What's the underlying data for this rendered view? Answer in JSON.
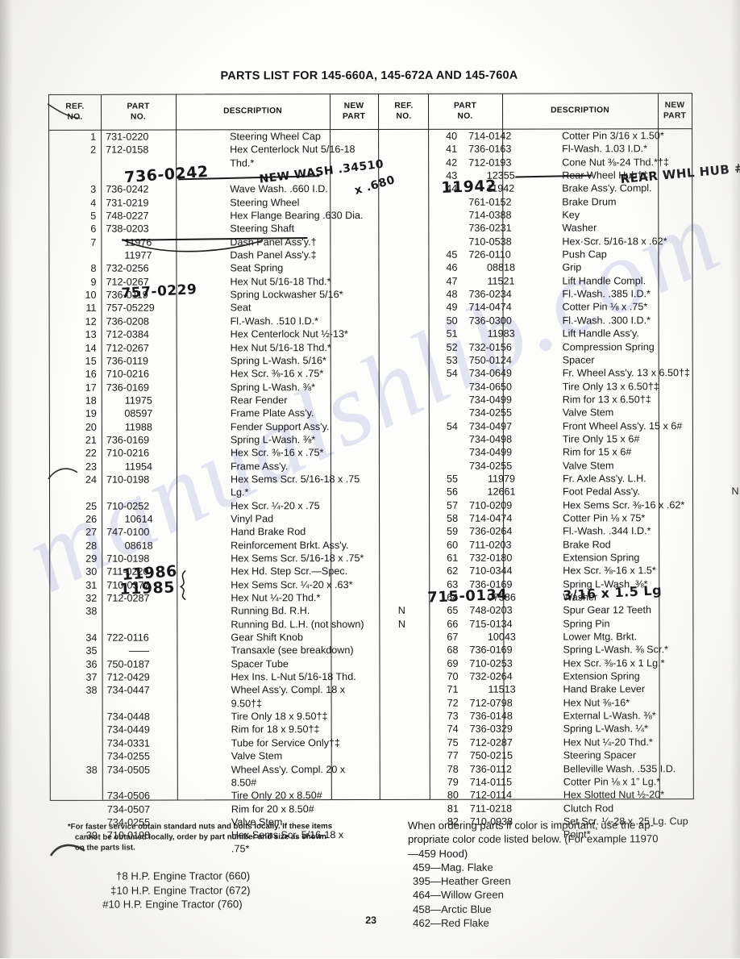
{
  "document": {
    "title": "PARTS LIST FOR 145-660A, 145-672A AND 145-760A",
    "page_number": "23"
  },
  "table": {
    "headers": {
      "ref_no_line1": "REF.",
      "ref_no_line2": "NO.",
      "part_no_line1": "PART",
      "part_no_line2": "NO.",
      "description": "DESCRIPTION",
      "new_part_line1": "NEW",
      "new_part_line2": "PART"
    },
    "left_rows": [
      {
        "ref": "1",
        "part": "731-0220",
        "desc": "Steering Wheel Cap",
        "new": ""
      },
      {
        "ref": "2",
        "part": "712-0158",
        "desc": "Hex Centerlock Nut 5/16-18\n   Thd.*",
        "new": "",
        "tall": true
      },
      {
        "ref": "",
        "part": "",
        "desc": "",
        "new": "",
        "gap": true
      },
      {
        "ref": "3",
        "part": "736-0242",
        "desc": "Wave Wash. .660 I.D.",
        "new": "",
        "struck": true
      },
      {
        "ref": "4",
        "part": "731-0219",
        "desc": "Steering Wheel",
        "new": ""
      },
      {
        "ref": "5",
        "part": "748-0227",
        "desc": "Hex Flange Bearing .630 Dia.",
        "new": ""
      },
      {
        "ref": "6",
        "part": "738-0203",
        "desc": "Steering Shaft",
        "new": ""
      },
      {
        "ref": "7",
        "part": "11976",
        "desc": "Dash Panel Ass'y.†",
        "new": "",
        "center": true
      },
      {
        "ref": "",
        "part": "11977",
        "desc": "Dash Panel Ass'y.‡",
        "new": "",
        "center": true,
        "struck": true
      },
      {
        "ref": "8",
        "part": "732-0256",
        "desc": "Seat Spring",
        "new": ""
      },
      {
        "ref": "9",
        "part": "712-0267",
        "desc": "Hex Nut 5/16-18 Thd.*",
        "new": ""
      },
      {
        "ref": "10",
        "part": "736-0119",
        "desc": "Spring Lockwasher 5/16*",
        "new": ""
      },
      {
        "ref": "11",
        "part": "757-05229",
        "desc": "Seat",
        "new": ""
      },
      {
        "ref": "12",
        "part": "736-0208",
        "desc": "Fl.-Wash. .510 I.D.*",
        "new": ""
      },
      {
        "ref": "13",
        "part": "712-0384",
        "desc": "Hex Centerlock Nut ½-13*",
        "new": ""
      },
      {
        "ref": "14",
        "part": "712-0267",
        "desc": "Hex Nut 5/16-18 Thd.*",
        "new": ""
      },
      {
        "ref": "15",
        "part": "736-0119",
        "desc": "Spring L-Wash. 5/16*",
        "new": ""
      },
      {
        "ref": "16",
        "part": "710-0216",
        "desc": "Hex Scr. ⅜-16 x .75*",
        "new": ""
      },
      {
        "ref": "17",
        "part": "736-0169",
        "desc": "Spring L-Wash. ⅜*",
        "new": ""
      },
      {
        "ref": "18",
        "part": "11975",
        "desc": "Rear Fender",
        "new": "",
        "center": true
      },
      {
        "ref": "19",
        "part": "08597",
        "desc": "Frame Plate Ass'y.",
        "new": "",
        "center": true
      },
      {
        "ref": "20",
        "part": "11988",
        "desc": "Fender Support Ass'y.",
        "new": "",
        "center": true
      },
      {
        "ref": "21",
        "part": "736-0169",
        "desc": "Spring L-Wash. ⅜*",
        "new": ""
      },
      {
        "ref": "22",
        "part": "710-0216",
        "desc": "Hex Scr. ⅜-16 x .75*",
        "new": ""
      },
      {
        "ref": "23",
        "part": "11954",
        "desc": "Frame Ass'y.",
        "new": "",
        "center": true
      },
      {
        "ref": "24",
        "part": "710-0198",
        "desc": "Hex Sems Scr. 5/16-18 x .75\n   Lg.*",
        "new": "",
        "tall": true
      },
      {
        "ref": "25",
        "part": "710-0252",
        "desc": "Hex Scr. ¼-20 x .75",
        "new": ""
      },
      {
        "ref": "26",
        "part": "10614",
        "desc": "Vinyl Pad",
        "new": "",
        "center": true
      },
      {
        "ref": "27",
        "part": "747-0100",
        "desc": "Hand Brake Rod",
        "new": ""
      },
      {
        "ref": "28",
        "part": "08618",
        "desc": "Reinforcement Brkt.  Ass'y.",
        "new": "",
        "center": true
      },
      {
        "ref": "29",
        "part": "710-0198",
        "desc": "Hex Sems Scr. 5/16-18 x .75*",
        "new": ""
      },
      {
        "ref": "30",
        "part": "711-0220",
        "desc": "Hex Hd. Step Scr.—Spec.",
        "new": ""
      },
      {
        "ref": "31",
        "part": "710-0377",
        "desc": "Hex Sems Scr. ¼-20 x .63*",
        "new": ""
      },
      {
        "ref": "32",
        "part": "712-0287",
        "desc": "Hex Nut ¼-20 Thd.*",
        "new": ""
      },
      {
        "ref": "38",
        "part": "",
        "desc": "Running Bd. R.H.",
        "new": "N"
      },
      {
        "ref": "",
        "part": "",
        "desc": "Running Bd. L.H. (not shown)",
        "new": "N"
      },
      {
        "ref": "34",
        "part": "722-0116",
        "desc": "Gear Shift Knob",
        "new": ""
      },
      {
        "ref": "35",
        "part": "——",
        "desc": "Transaxle (see breakdown)",
        "new": "",
        "center": true
      },
      {
        "ref": "36",
        "part": "750-0187",
        "desc": "Spacer Tube",
        "new": ""
      },
      {
        "ref": "37",
        "part": "712-0429",
        "desc": "Hex Ins. L-Nut 5/16-18 Thd.",
        "new": ""
      },
      {
        "ref": "38",
        "part": "734-0447",
        "desc": "Wheel Ass'y. Compl. 18 x\n   9.50†‡",
        "new": "",
        "tall": true
      },
      {
        "ref": "",
        "part": "734-0448",
        "desc": "Tire Only 18 x 9.50†‡",
        "new": ""
      },
      {
        "ref": "",
        "part": "734-0449",
        "desc": "Rim for 18 x 9.50†‡",
        "new": ""
      },
      {
        "ref": "",
        "part": "734-0331",
        "desc": "Tube for Service Only†‡",
        "new": ""
      },
      {
        "ref": "",
        "part": "734-0255",
        "desc": "Valve Stem",
        "new": ""
      },
      {
        "ref": "38",
        "part": "734-0505",
        "desc": "Wheel Ass'y. Compl. 20 x\n   8.50#",
        "new": "",
        "tall": true
      },
      {
        "ref": "",
        "part": "734-0506",
        "desc": "Tire Only 20 x 8.50#",
        "new": ""
      },
      {
        "ref": "",
        "part": "734-0507",
        "desc": "Rim for 20 x 8.50#",
        "new": ""
      },
      {
        "ref": "",
        "part": "734-0255",
        "desc": "Valve Stem",
        "new": ""
      },
      {
        "ref": "39",
        "part": "710-0198",
        "desc": "Hex Sems Scr. 5/16-18 x\n   .75*",
        "new": "",
        "tall": true
      }
    ],
    "right_rows": [
      {
        "ref": "40",
        "part": "714-0142",
        "desc": "Cotter Pin 3/16 x 1.50*",
        "new": ""
      },
      {
        "ref": "41",
        "part": "736-0163",
        "desc": "Fl-Wash. 1.03 I.D.*",
        "new": ""
      },
      {
        "ref": "42",
        "part": "712-0193",
        "desc": "Cone Nut ⅜-24 Thd.*†‡",
        "new": ""
      },
      {
        "ref": "43",
        "part": "12355",
        "desc": "Rear Wheel Hub†‡",
        "new": "",
        "center": true
      },
      {
        "ref": "44",
        "part": "11942",
        "desc": "Brake Ass'y. Compl.",
        "new": "",
        "center": true
      },
      {
        "ref": "",
        "part": "761-0152",
        "desc": "Brake Drum",
        "new": ""
      },
      {
        "ref": "",
        "part": "714-0388",
        "desc": "Key",
        "new": ""
      },
      {
        "ref": "",
        "part": "736-0231",
        "desc": "Washer",
        "new": ""
      },
      {
        "ref": "",
        "part": "710-0538",
        "desc": "Hex·Scr. 5/16-18 x .62*",
        "new": ""
      },
      {
        "ref": "45",
        "part": "726-0110",
        "desc": "Push Cap",
        "new": ""
      },
      {
        "ref": "46",
        "part": "08818",
        "desc": "Grip",
        "new": "",
        "center": true
      },
      {
        "ref": "47",
        "part": "11521",
        "desc": "Lift Handle Compl.",
        "new": "",
        "center": true
      },
      {
        "ref": "48",
        "part": "736-0234",
        "desc": "Fl.-Wash. .385 I.D.*",
        "new": ""
      },
      {
        "ref": "49",
        "part": "714-0474",
        "desc": "Cotter Pin ⅛ x .75*",
        "new": ""
      },
      {
        "ref": "50",
        "part": "736-0300",
        "desc": "Fl.-Wash. .300 I.D.*",
        "new": ""
      },
      {
        "ref": "51",
        "part": "11983",
        "desc": "Lift Handle Ass'y.",
        "new": "",
        "center": true
      },
      {
        "ref": "52",
        "part": "732-0156",
        "desc": "Compression Spring",
        "new": ""
      },
      {
        "ref": "53",
        "part": "750-0124",
        "desc": "Spacer",
        "new": ""
      },
      {
        "ref": "54",
        "part": "734-0649",
        "desc": "Fr. Wheel Ass'y. 13 x 6.50†‡",
        "new": ""
      },
      {
        "ref": "",
        "part": "734-0650",
        "desc": "Tire Only 13 x 6.50†‡",
        "new": ""
      },
      {
        "ref": "",
        "part": "734-0499",
        "desc": "Rim for 13 x 6.50†‡",
        "new": ""
      },
      {
        "ref": "",
        "part": "734-0255",
        "desc": "Valve Stem",
        "new": ""
      },
      {
        "ref": "54",
        "part": "734-0497",
        "desc": "Front Wheel Ass'y. 15 x 6#",
        "new": ""
      },
      {
        "ref": "",
        "part": "734-0498",
        "desc": "Tire Only 15 x 6#",
        "new": ""
      },
      {
        "ref": "",
        "part": "734-0499",
        "desc": "Rim for 15 x 6#",
        "new": ""
      },
      {
        "ref": "",
        "part": "734-0255",
        "desc": "Valve Stem",
        "new": ""
      },
      {
        "ref": "55",
        "part": "11979",
        "desc": "Fr. Axle Ass'y. L.H.",
        "new": "",
        "center": true
      },
      {
        "ref": "56",
        "part": "12661",
        "desc": "Foot Pedal Ass'y.",
        "new": "N",
        "center": true
      },
      {
        "ref": "57",
        "part": "710-0209",
        "desc": "Hex Sems Scr. ⅜-16 x .62*",
        "new": ""
      },
      {
        "ref": "58",
        "part": "714-0474",
        "desc": "Cotter Pin ⅛ x 75*",
        "new": ""
      },
      {
        "ref": "59",
        "part": "736-0264",
        "desc": "Fl.-Wash. .344 I.D.*",
        "new": ""
      },
      {
        "ref": "60",
        "part": "711-0203",
        "desc": "Brake Rod",
        "new": ""
      },
      {
        "ref": "61",
        "part": "732-0180",
        "desc": "Extension Spring",
        "new": ""
      },
      {
        "ref": "62",
        "part": "710-0344",
        "desc": "Hex Scr. ⅜-16 x 1.5*",
        "new": ""
      },
      {
        "ref": "63",
        "part": "736-0169",
        "desc": "Spring L-Wash. ⅜*",
        "new": ""
      },
      {
        "ref": "64",
        "part": "07386",
        "desc": "Washer",
        "new": "",
        "center": true
      },
      {
        "ref": "65",
        "part": "748-0203",
        "desc": "Spur Gear 12 Teeth",
        "new": ""
      },
      {
        "ref": "66",
        "part": "715-0134",
        "desc": "Spring Pin",
        "new": ""
      },
      {
        "ref": "67",
        "part": "10043",
        "desc": "Lower Mtg. Brkt.",
        "new": "",
        "center": true
      },
      {
        "ref": "68",
        "part": "736-0169",
        "desc": "Spring L-Wash. ⅜ Scr.*",
        "new": ""
      },
      {
        "ref": "69",
        "part": "710-0253",
        "desc": "Hex Scr. ⅜-16 x 1 Lg.*",
        "new": ""
      },
      {
        "ref": "70",
        "part": "732-0264",
        "desc": "Extension Spring",
        "new": ""
      },
      {
        "ref": "71",
        "part": "11513",
        "desc": "Hand Brake Lever",
        "new": "",
        "center": true
      },
      {
        "ref": "72",
        "part": "712-0798",
        "desc": "Hex Nut ⅜-16*",
        "new": ""
      },
      {
        "ref": "73",
        "part": "736-0148",
        "desc": "External L-Wash. ⅜*",
        "new": ""
      },
      {
        "ref": "74",
        "part": "736-0329",
        "desc": "Spring L-Wash. ¼*",
        "new": ""
      },
      {
        "ref": "75",
        "part": "712-0287",
        "desc": "Hex Nut ¼-20 Thd.*",
        "new": ""
      },
      {
        "ref": "77",
        "part": "750-0215",
        "desc": "Steering Spacer",
        "new": ""
      },
      {
        "ref": "78",
        "part": "736-0112",
        "desc": "Belleville Wash. .535 I.D.",
        "new": ""
      },
      {
        "ref": "79",
        "part": "714-0115",
        "desc": "Cotter Pin ⅛ x 1” Lg.*",
        "new": ""
      },
      {
        "ref": "80",
        "part": "712-0114",
        "desc": "Hex Slotted Nut ½-20*",
        "new": ""
      },
      {
        "ref": "81",
        "part": "711-0218",
        "desc": "Clutch Rod",
        "new": ""
      },
      {
        "ref": "82",
        "part": "710-0938",
        "desc": "Set Scr. ¼-28 x .25 Lg. Cup\n   Point*",
        "new": "",
        "tall": true
      }
    ]
  },
  "handwriting": {
    "part_3_correction": "736-0242",
    "new_wash_note": "NEW WASH .34510",
    "new_wash_note2": "x .680",
    "part_11_correction": "757-0229",
    "running_bd_rh": "11986",
    "running_bd_lh": "11985",
    "part_43_margin": "REAR WHL HUB #",
    "part_44_correction": "11942",
    "part_66_correction": "715-0134",
    "part_66_size": "3/16 x 1.5 Lg"
  },
  "footnotes": {
    "asterisk_note_line1": "*For faster service obtain standard nuts and bolts locally. If these items",
    "asterisk_note_line2": "cannot be obtained locally, order by part number and size as shown",
    "asterisk_note_line3": "on the parts list.",
    "engine_notes": [
      "†8 H.P. Engine Tractor (660)",
      "‡10 H.P. Engine Tractor (672)",
      "#10 H.P. Engine Tractor (760)"
    ],
    "color_intro_line1": "When ordering parts if color is important, use the ap-",
    "color_intro_line2": "propriate color code listed below. (For example 11970",
    "color_intro_line3": "—459 Hood)",
    "color_codes": [
      "459—Mag. Flake",
      "395—Heather Green",
      "464—Willow Green",
      "458—Arctic Blue",
      "462—Red Flake"
    ]
  },
  "watermark": {
    "text": "manualshlib.com"
  }
}
